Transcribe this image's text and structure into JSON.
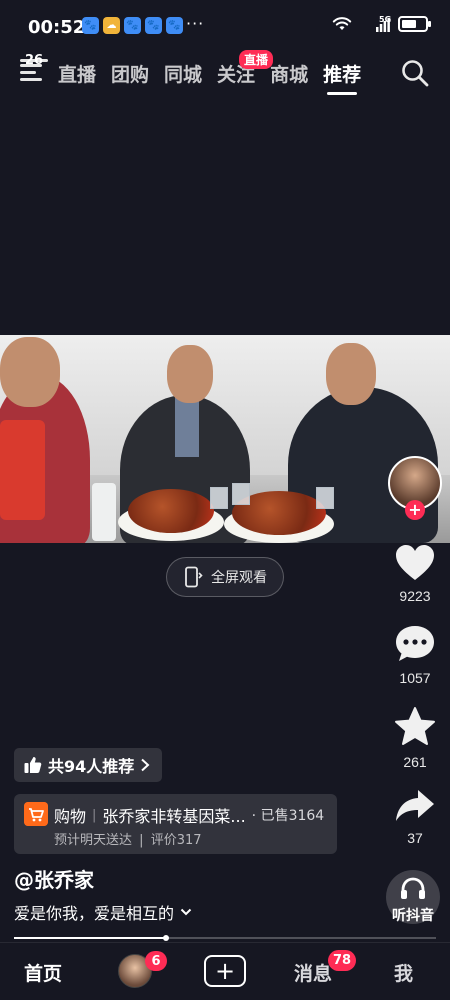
{
  "status_bar": {
    "time": "00:52",
    "more": "···",
    "network": "5G",
    "battery_level": 0.7
  },
  "top_nav": {
    "menu_badge": "26",
    "tabs": [
      {
        "label": "直播"
      },
      {
        "label": "团购"
      },
      {
        "label": "同城"
      },
      {
        "label": "关注",
        "badge": "直播"
      },
      {
        "label": "商城"
      },
      {
        "label": "推荐"
      }
    ],
    "active_tab": "推荐"
  },
  "video": {
    "fullscreen_label": "全屏观看"
  },
  "actions": {
    "likes": "9223",
    "comments": "1057",
    "favorites": "261",
    "shares": "37",
    "avatar_plus": "+"
  },
  "recommend": {
    "label": "共94人推荐"
  },
  "shop": {
    "type": "购物",
    "title": "张乔家非转基因菜...",
    "sold": "· 已售3164",
    "delivery": "预计明天送达",
    "reviews": "评价317"
  },
  "author": "@张乔家",
  "caption": "爱是你我，爱是相互的",
  "listen_label": "听抖音",
  "progress": 0.36,
  "bottom_nav": {
    "home": "首页",
    "friend_badge": "6",
    "create": "+",
    "messages": "消息",
    "messages_badge": "78",
    "me": "我"
  },
  "colors": {
    "accent": "#fe2c55",
    "background": "#161722",
    "shop_icon": "#ff6a1a"
  }
}
